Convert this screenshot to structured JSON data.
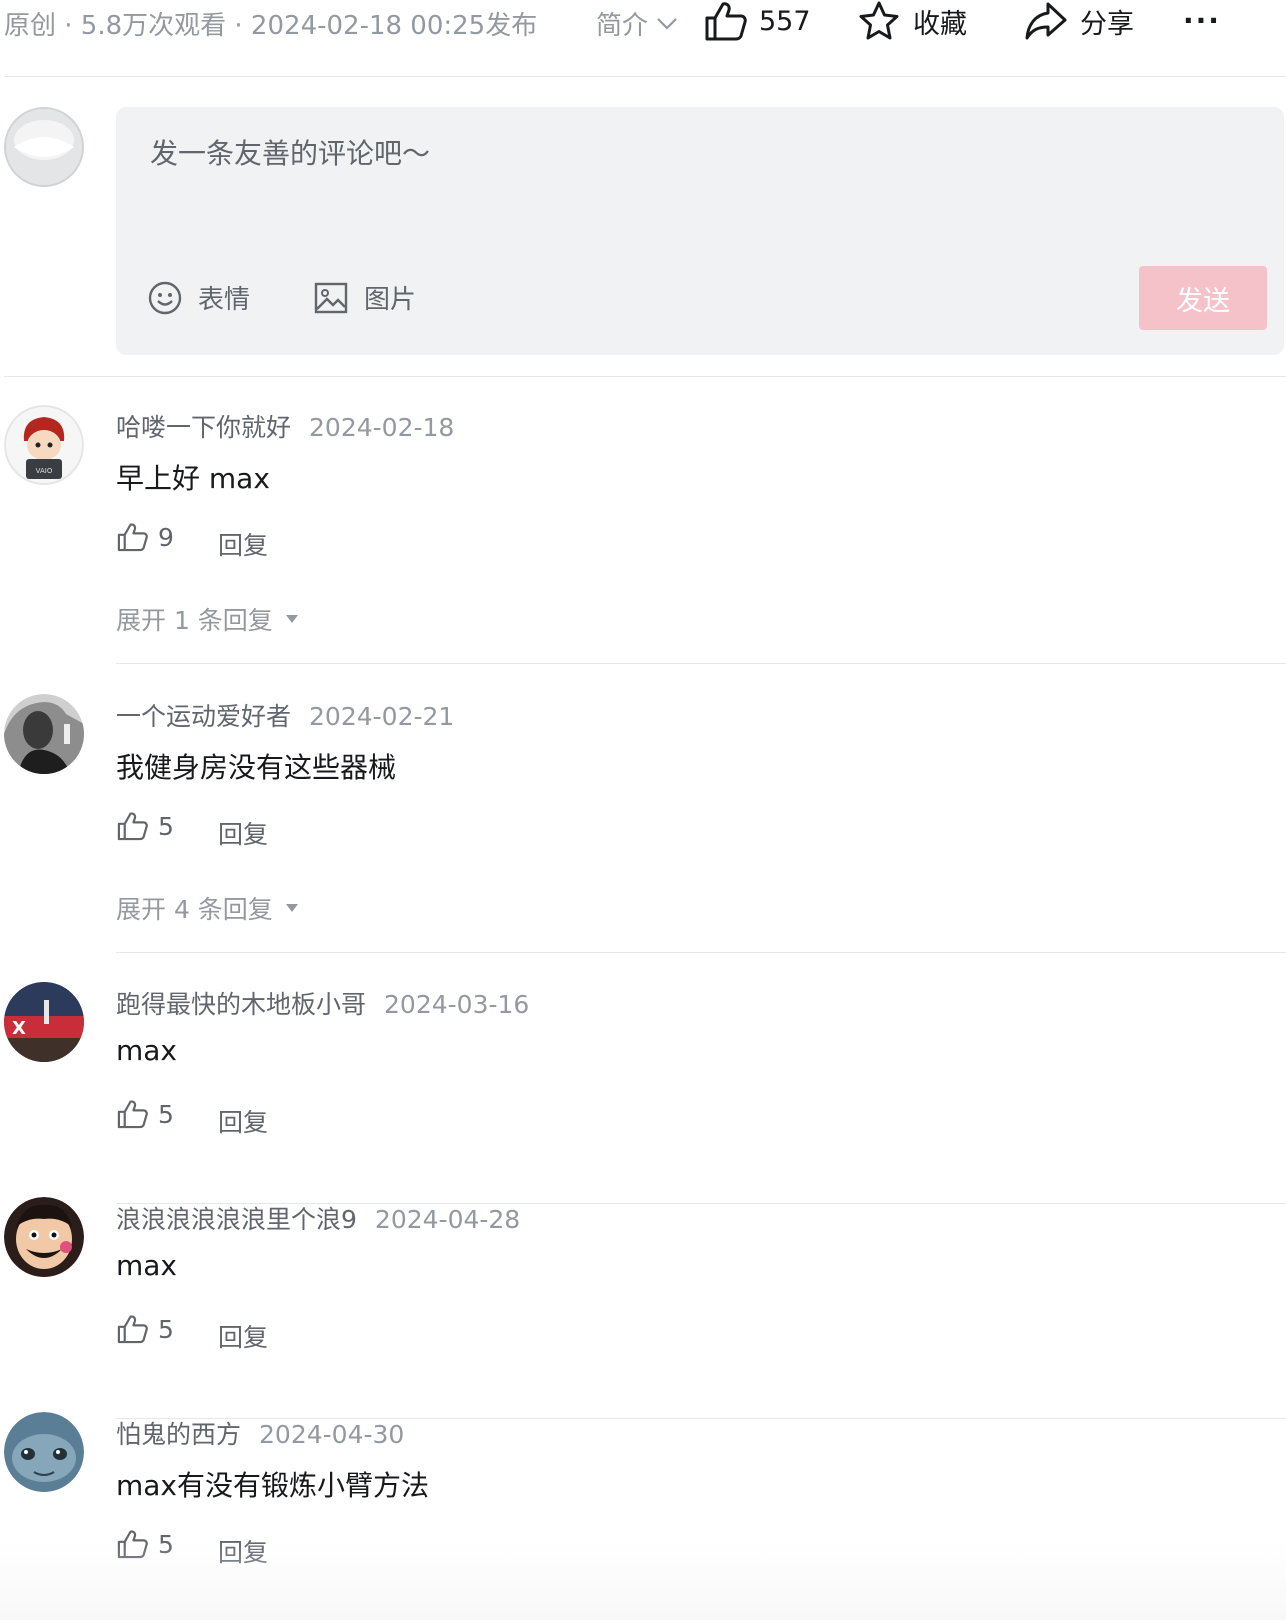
{
  "header": {
    "meta": "原创 · 5.8万次观看 · 2024-02-18 00:25发布",
    "intro_label": "简介",
    "like_count": "557",
    "favorite_label": "收藏",
    "share_label": "分享",
    "more_label": "···"
  },
  "editor": {
    "placeholder": "发一条友善的评论吧～",
    "emoji_label": "表情",
    "image_label": "图片",
    "send_label": "发送"
  },
  "comments": [
    {
      "name": "哈喽一下你就好",
      "date": "2024-02-18",
      "text": "早上好 max",
      "likes": "9",
      "reply_label": "回复",
      "expand": "展开 1 条回复"
    },
    {
      "name": "一个运动爱好者",
      "date": "2024-02-21",
      "text": "我健身房没有这些器械",
      "likes": "5",
      "reply_label": "回复",
      "expand": "展开 4 条回复"
    },
    {
      "name": "跑得最快的木地板小哥",
      "date": "2024-03-16",
      "text": "max",
      "likes": "5",
      "reply_label": "回复"
    },
    {
      "name": "浪浪浪浪浪浪里个浪9",
      "date": "2024-04-28",
      "text": "max",
      "likes": "5",
      "reply_label": "回复"
    },
    {
      "name": "怕鬼的西方",
      "date": "2024-04-30",
      "text": "max有没有锻炼小臂方法",
      "likes": "5",
      "reply_label": "回复"
    }
  ],
  "colors": {
    "send_disabled": "#f5c2ca",
    "editor_bg": "#f1f2f3",
    "muted_text": "#9499a0"
  }
}
